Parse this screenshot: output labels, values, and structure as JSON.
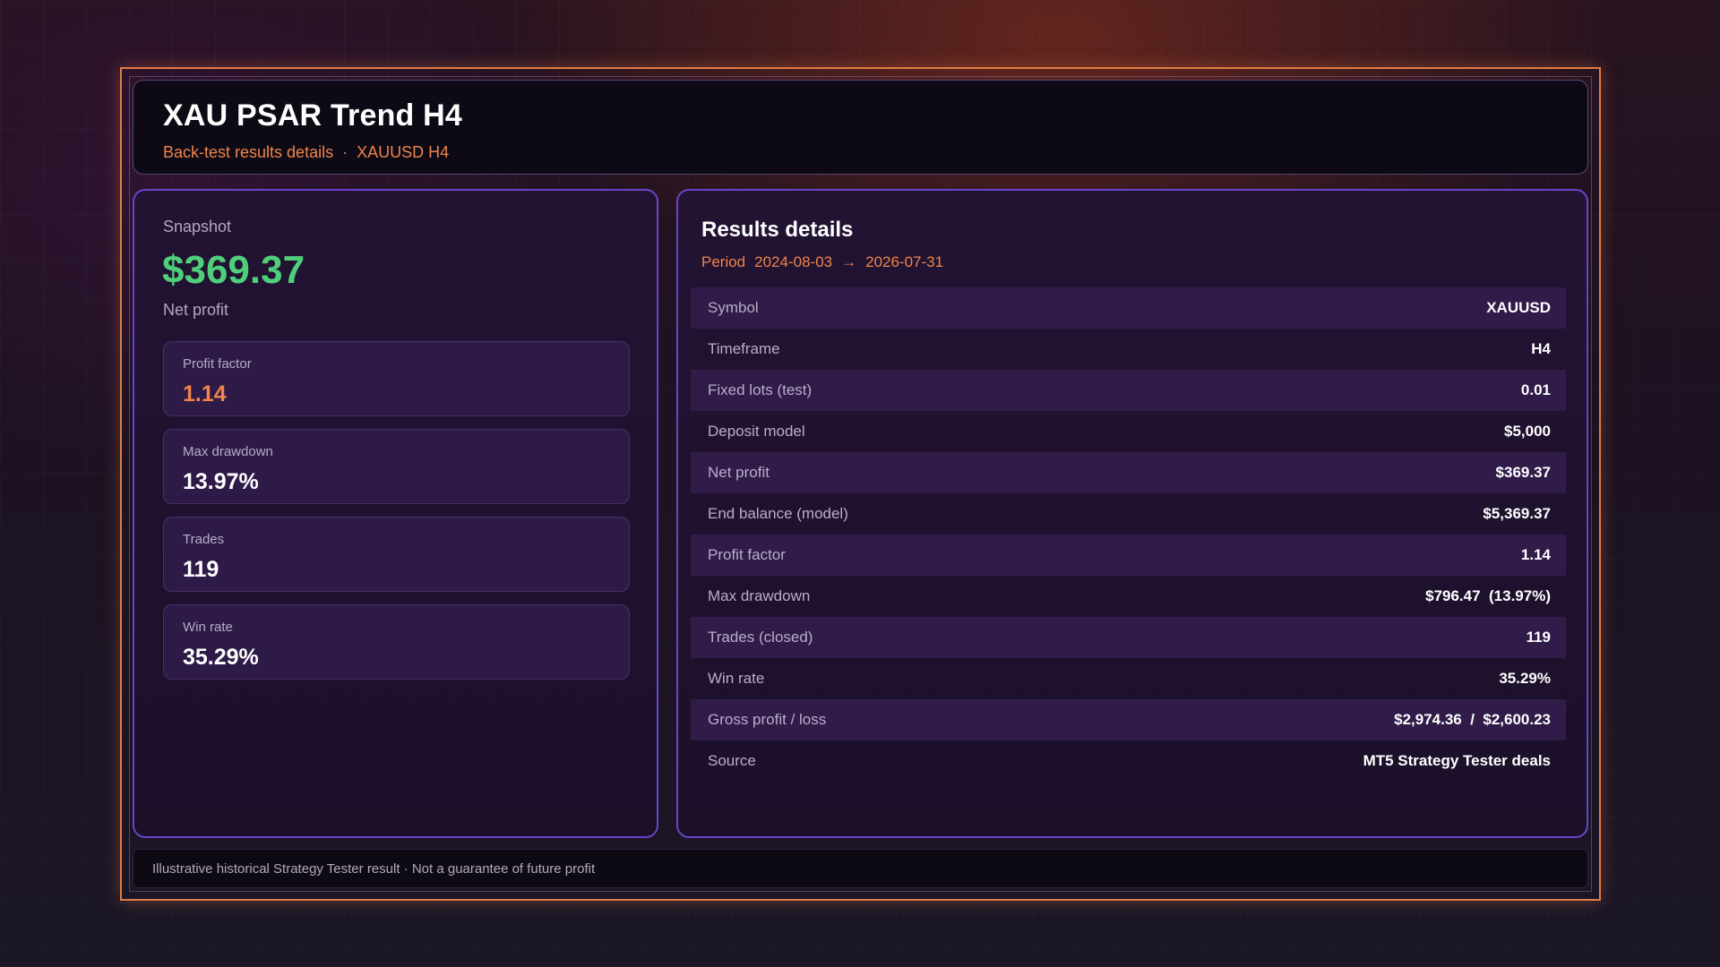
{
  "header": {
    "title": "XAU PSAR Trend H4",
    "subtitle_left": "Back-test results details",
    "subtitle_sep": "·",
    "subtitle_right": "XAUUSD H4"
  },
  "snapshot": {
    "label": "Snapshot",
    "value": "$369.37",
    "caption": "Net profit",
    "metrics": [
      {
        "label": "Profit factor",
        "value": "1.14"
      },
      {
        "label": "Max drawdown",
        "value": "13.97%"
      },
      {
        "label": "Trades",
        "value": "119"
      },
      {
        "label": "Win rate",
        "value": "35.29%"
      }
    ]
  },
  "results": {
    "title": "Results details",
    "period_label": "Period",
    "period_start": "2024-08-03",
    "period_arrow": "→",
    "period_end": "2026-07-31",
    "rows": [
      {
        "key": "Symbol",
        "value": "XAUUSD"
      },
      {
        "key": "Timeframe",
        "value": "H4"
      },
      {
        "key": "Fixed lots (test)",
        "value": "0.01"
      },
      {
        "key": "Deposit model",
        "value": "$5,000"
      },
      {
        "key": "Net profit",
        "value": "$369.37"
      },
      {
        "key": "End balance (model)",
        "value": "$5,369.37"
      },
      {
        "key": "Profit factor",
        "value": "1.14"
      },
      {
        "key": "Max drawdown",
        "value": "$796.47  (13.97%)"
      },
      {
        "key": "Trades (closed)",
        "value": "119"
      },
      {
        "key": "Win rate",
        "value": "35.29%"
      },
      {
        "key": "Gross profit / loss",
        "value": "$2,974.36  /  $2,600.23"
      },
      {
        "key": "Source",
        "value": "MT5 Strategy Tester deals"
      }
    ]
  },
  "footer": {
    "disclaimer": "Illustrative historical Strategy Tester result · Not a guarantee of future profit"
  },
  "colors": {
    "accent_orange": "#f0844a",
    "profit_green": "#4fcf7a",
    "panel_border": "#6a44c8",
    "frame_border": "#e07b45"
  }
}
